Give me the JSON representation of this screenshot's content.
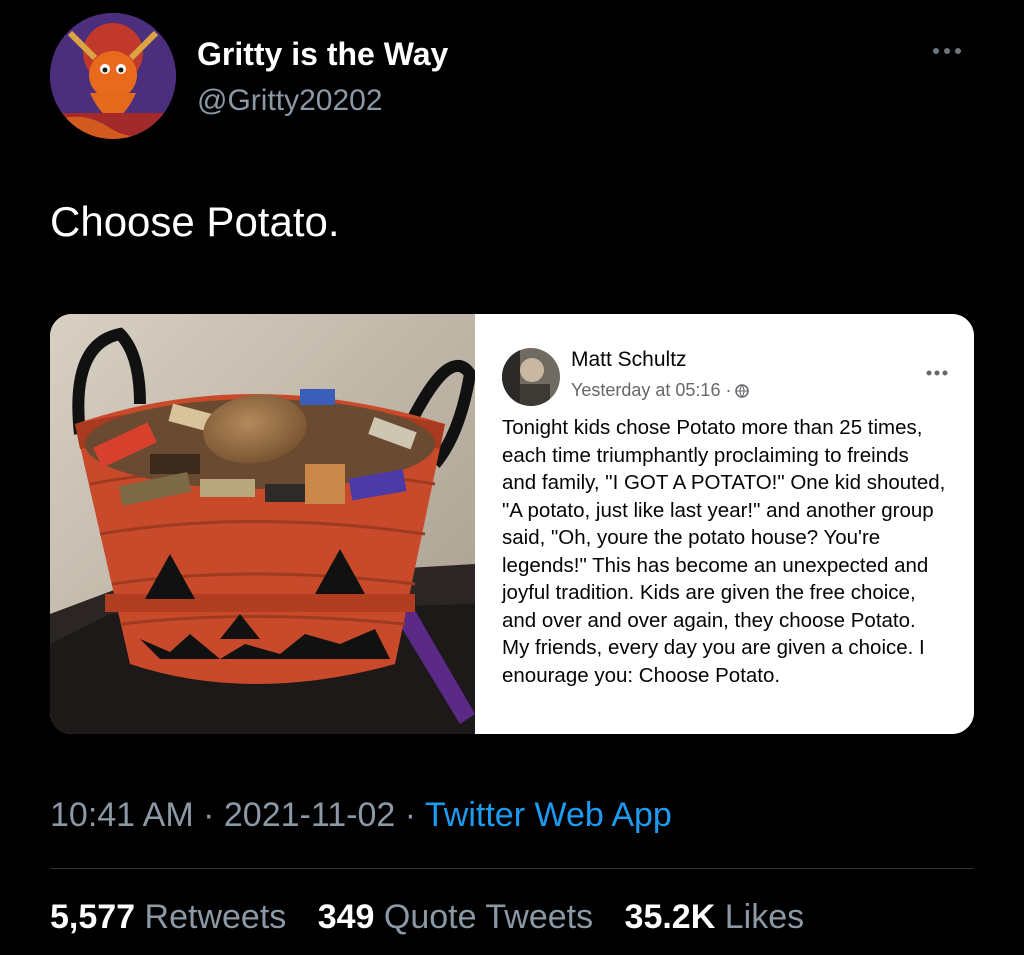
{
  "author": {
    "display_name": "Gritty is the Way",
    "handle": "@Gritty20202",
    "avatar_icon": "gritty-avatar"
  },
  "tweet": {
    "text": "Choose Potato.",
    "time": "10:41 AM",
    "date": "2021-11-02",
    "separator": " · ",
    "source": "Twitter Web App"
  },
  "embedded_post": {
    "author_name": "Matt Schultz",
    "timestamp": "Yesterday at 05:16 ·",
    "body_lines": [
      "Tonight kids chose Potato more than 25 times,",
      "each time triumphantly proclaiming to freinds",
      "and family, \"I GOT A POTATO!\" One kid shouted,",
      "\"A potato, just like last year!\" and another group",
      "said, \"Oh, youre the potato house? You're",
      "legends!\" This has become an unexpected and",
      "joyful tradition. Kids are given the free choice,",
      "and over and over again, they choose Potato.",
      "My friends, every day you are given a choice. I",
      "enourage you: Choose Potato."
    ]
  },
  "stats": {
    "retweets_count": "5,577",
    "retweets_label": "Retweets",
    "quotes_count": "349",
    "quotes_label": "Quote Tweets",
    "likes_count": "35.2K",
    "likes_label": "Likes"
  },
  "colors": {
    "background": "#000000",
    "primary_text": "#ffffff",
    "secondary_text": "#8b98a5",
    "link": "#1d9bf0",
    "divider": "#2f3336"
  }
}
